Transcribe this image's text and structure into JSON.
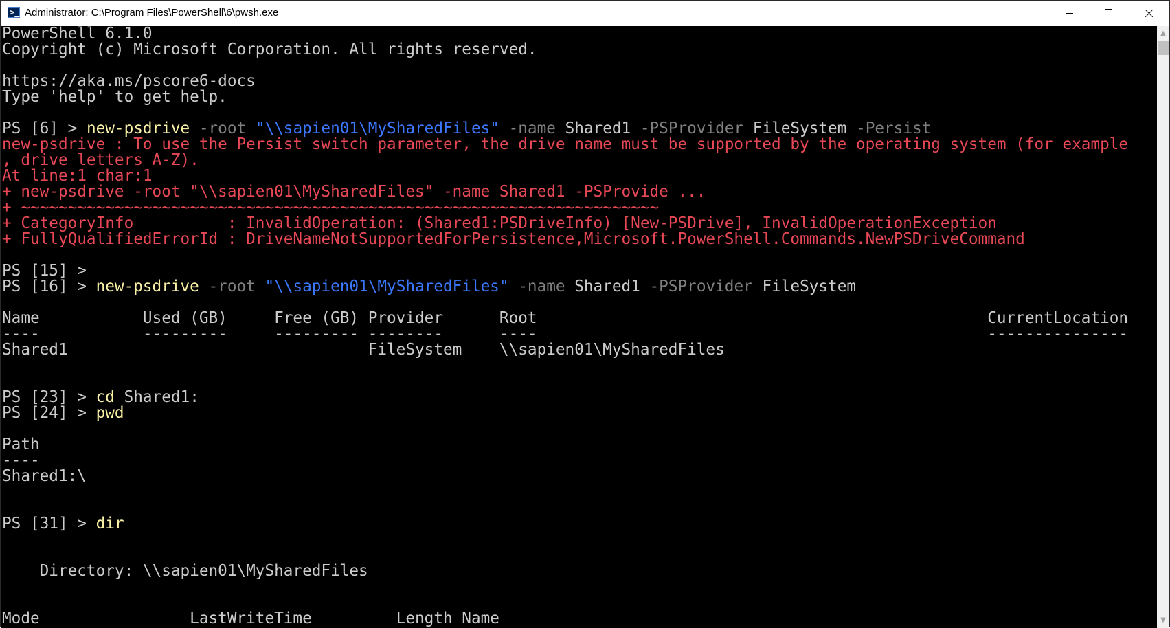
{
  "window": {
    "title": "Administrator: C:\\Program Files\\PowerShell\\6\\pwsh.exe",
    "controls": {
      "minimize": "minimize",
      "maximize": "maximize",
      "close": "close"
    }
  },
  "console": {
    "colors": {
      "background": "#000000",
      "default": "#cccccc",
      "command": "#f9f1a5",
      "parameter": "#808080",
      "string": "#3b78ff",
      "error": "#e74856"
    },
    "lines": [
      [
        {
          "t": "PowerShell 6.1.0",
          "c": "def"
        }
      ],
      [
        {
          "t": "Copyright (c) Microsoft Corporation. All rights reserved.",
          "c": "def"
        }
      ],
      [
        {
          "t": "",
          "c": "def"
        }
      ],
      [
        {
          "t": "https://aka.ms/pscore6-docs",
          "c": "def"
        }
      ],
      [
        {
          "t": "Type 'help' to get help.",
          "c": "def"
        }
      ],
      [
        {
          "t": "",
          "c": "def"
        }
      ],
      [
        {
          "t": "PS [6] > ",
          "c": "def"
        },
        {
          "t": "new-psdrive",
          "c": "cmd"
        },
        {
          "t": " -root ",
          "c": "param"
        },
        {
          "t": "\"\\\\sapien01\\MySharedFiles\"",
          "c": "str"
        },
        {
          "t": " -name ",
          "c": "param"
        },
        {
          "t": "Shared1",
          "c": "def"
        },
        {
          "t": " -PSProvider ",
          "c": "param"
        },
        {
          "t": "FileSystem",
          "c": "def"
        },
        {
          "t": " -Persist",
          "c": "param"
        }
      ],
      [
        {
          "t": "new-psdrive : To use the Persist switch parameter, the drive name must be supported by the operating system (for example",
          "c": "err"
        }
      ],
      [
        {
          "t": ", drive letters A-Z).",
          "c": "err"
        }
      ],
      [
        {
          "t": "At line:1 char:1",
          "c": "err"
        }
      ],
      [
        {
          "t": "+ new-psdrive -root \"\\\\sapien01\\MySharedFiles\" -name Shared1 -PSProvide ...",
          "c": "err"
        }
      ],
      [
        {
          "t": "+ ~~~~~~~~~~~~~~~~~~~~~~~~~~~~~~~~~~~~~~~~~~~~~~~~~~~~~~~~~~~~~~~~~~~~",
          "c": "err"
        }
      ],
      [
        {
          "t": "+ CategoryInfo          : InvalidOperation: (Shared1:PSDriveInfo) [New-PSDrive], InvalidOperationException",
          "c": "err"
        }
      ],
      [
        {
          "t": "+ FullyQualifiedErrorId : DriveNameNotSupportedForPersistence,Microsoft.PowerShell.Commands.NewPSDriveCommand",
          "c": "err"
        }
      ],
      [
        {
          "t": "",
          "c": "def"
        }
      ],
      [
        {
          "t": "PS [15] >",
          "c": "def"
        }
      ],
      [
        {
          "t": "PS [16] > ",
          "c": "def"
        },
        {
          "t": "new-psdrive",
          "c": "cmd"
        },
        {
          "t": " -root ",
          "c": "param"
        },
        {
          "t": "\"\\\\sapien01\\MySharedFiles\"",
          "c": "str"
        },
        {
          "t": " -name ",
          "c": "param"
        },
        {
          "t": "Shared1",
          "c": "def"
        },
        {
          "t": " -PSProvider ",
          "c": "param"
        },
        {
          "t": "FileSystem",
          "c": "def"
        }
      ],
      [
        {
          "t": "",
          "c": "def"
        }
      ],
      [
        {
          "t": "Name           Used (GB)     Free (GB) Provider      Root                                                CurrentLocation",
          "c": "def"
        }
      ],
      [
        {
          "t": "----           ---------     --------- --------      ----                                                ---------------",
          "c": "def"
        }
      ],
      [
        {
          "t": "Shared1                                FileSystem    \\\\sapien01\\MySharedFiles",
          "c": "def"
        }
      ],
      [
        {
          "t": "",
          "c": "def"
        }
      ],
      [
        {
          "t": "",
          "c": "def"
        }
      ],
      [
        {
          "t": "PS [23] > ",
          "c": "def"
        },
        {
          "t": "cd",
          "c": "cmd"
        },
        {
          "t": " Shared1:",
          "c": "def"
        }
      ],
      [
        {
          "t": "PS [24] > ",
          "c": "def"
        },
        {
          "t": "pwd",
          "c": "cmd"
        }
      ],
      [
        {
          "t": "",
          "c": "def"
        }
      ],
      [
        {
          "t": "Path",
          "c": "def"
        }
      ],
      [
        {
          "t": "----",
          "c": "def"
        }
      ],
      [
        {
          "t": "Shared1:\\",
          "c": "def"
        }
      ],
      [
        {
          "t": "",
          "c": "def"
        }
      ],
      [
        {
          "t": "",
          "c": "def"
        }
      ],
      [
        {
          "t": "PS [31] > ",
          "c": "def"
        },
        {
          "t": "dir",
          "c": "cmd"
        }
      ],
      [
        {
          "t": "",
          "c": "def"
        }
      ],
      [
        {
          "t": "",
          "c": "def"
        }
      ],
      [
        {
          "t": "    Directory: \\\\sapien01\\MySharedFiles",
          "c": "def"
        }
      ],
      [
        {
          "t": "",
          "c": "def"
        }
      ],
      [
        {
          "t": "",
          "c": "def"
        }
      ],
      [
        {
          "t": "Mode                LastWriteTime         Length Name",
          "c": "def"
        }
      ]
    ]
  }
}
